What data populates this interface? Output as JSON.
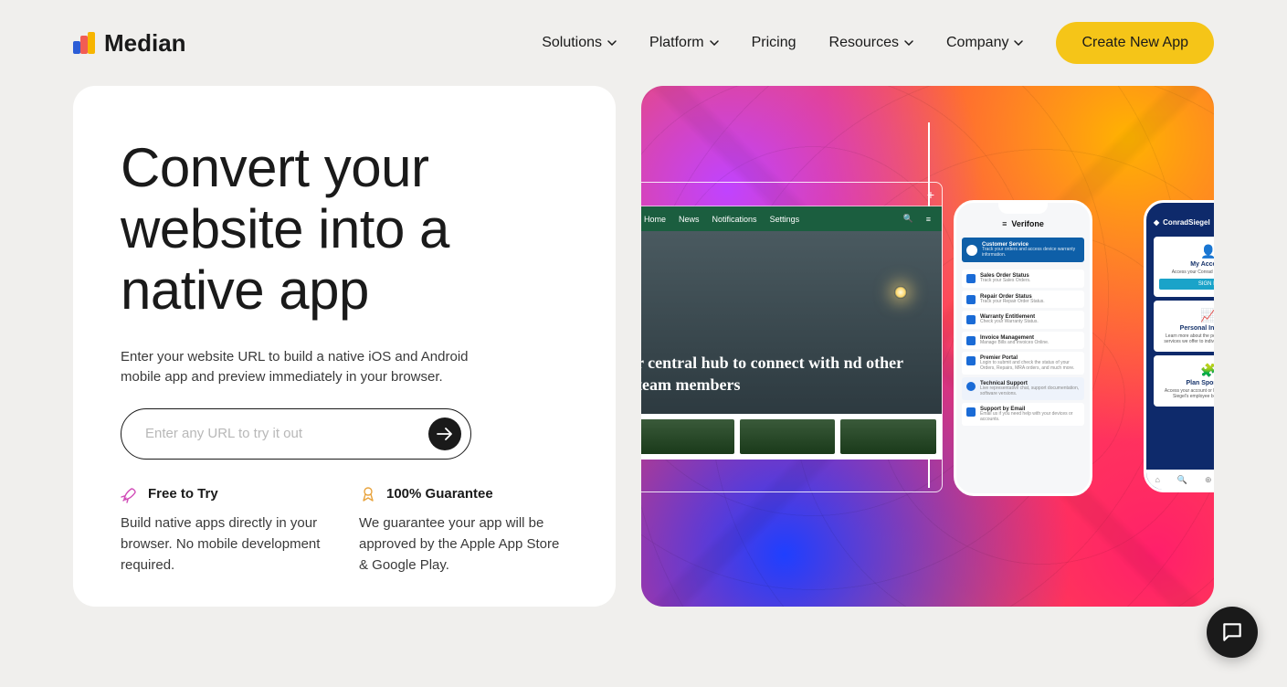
{
  "brand": {
    "name": "Median"
  },
  "nav": {
    "items": [
      {
        "label": "Solutions",
        "dropdown": true
      },
      {
        "label": "Platform",
        "dropdown": true
      },
      {
        "label": "Pricing",
        "dropdown": false
      },
      {
        "label": "Resources",
        "dropdown": true
      },
      {
        "label": "Company",
        "dropdown": true
      }
    ],
    "cta": "Create New App"
  },
  "hero": {
    "title": "Convert your website into a native app",
    "subtitle": "Enter your website URL to build a native iOS and Android mobile app and preview immediately in your browser.",
    "url_placeholder": "Enter any URL to try it out",
    "features": [
      {
        "title": "Free to Try",
        "body": "Build native apps directly in your browser. No mobile development required."
      },
      {
        "title": "100% Guarantee",
        "body": "We guarantee your app will be approved by the Apple App Store & Google Play."
      }
    ]
  },
  "showcase": {
    "browser": {
      "nav": [
        "Home",
        "News",
        "Notifications",
        "Settings"
      ],
      "hero_text": "r central hub to connect with nd other team members"
    },
    "phone1": {
      "brand": "Verifone",
      "head": {
        "title": "Customer Service",
        "sub": "Track your orders and access device warranty information."
      },
      "rows": [
        {
          "title": "Sales Order Status",
          "sub": "Track your Sales Orders."
        },
        {
          "title": "Repair Order Status",
          "sub": "Track your Repair Order Status."
        },
        {
          "title": "Warranty Entitlement",
          "sub": "Check your Warranty Status."
        },
        {
          "title": "Invoice Management",
          "sub": "Manage Bills and Invoices Online."
        },
        {
          "title": "Premier Portal",
          "sub": "Login to submit and check the status of your Orders, Repairs, MRA orders, and much more."
        },
        {
          "title": "Technical Support",
          "sub": "Live representative chat, support documentation, software versions."
        },
        {
          "title": "Support by Email",
          "sub": "Email us if you need help with your devices or accounts."
        }
      ]
    },
    "phone2": {
      "brand": "ConradSiegel",
      "panels": [
        {
          "title": "My Account",
          "sub": "Access your Conrad Siegel account.",
          "button": "SIGN IN"
        },
        {
          "title": "Personal Investors",
          "sub": "Learn more about the personal investment services we offer to individuals and families."
        },
        {
          "title": "Plan Sponsors",
          "sub": "Access your account or learn about Conrad Siegel's employee benefit services."
        }
      ]
    }
  }
}
